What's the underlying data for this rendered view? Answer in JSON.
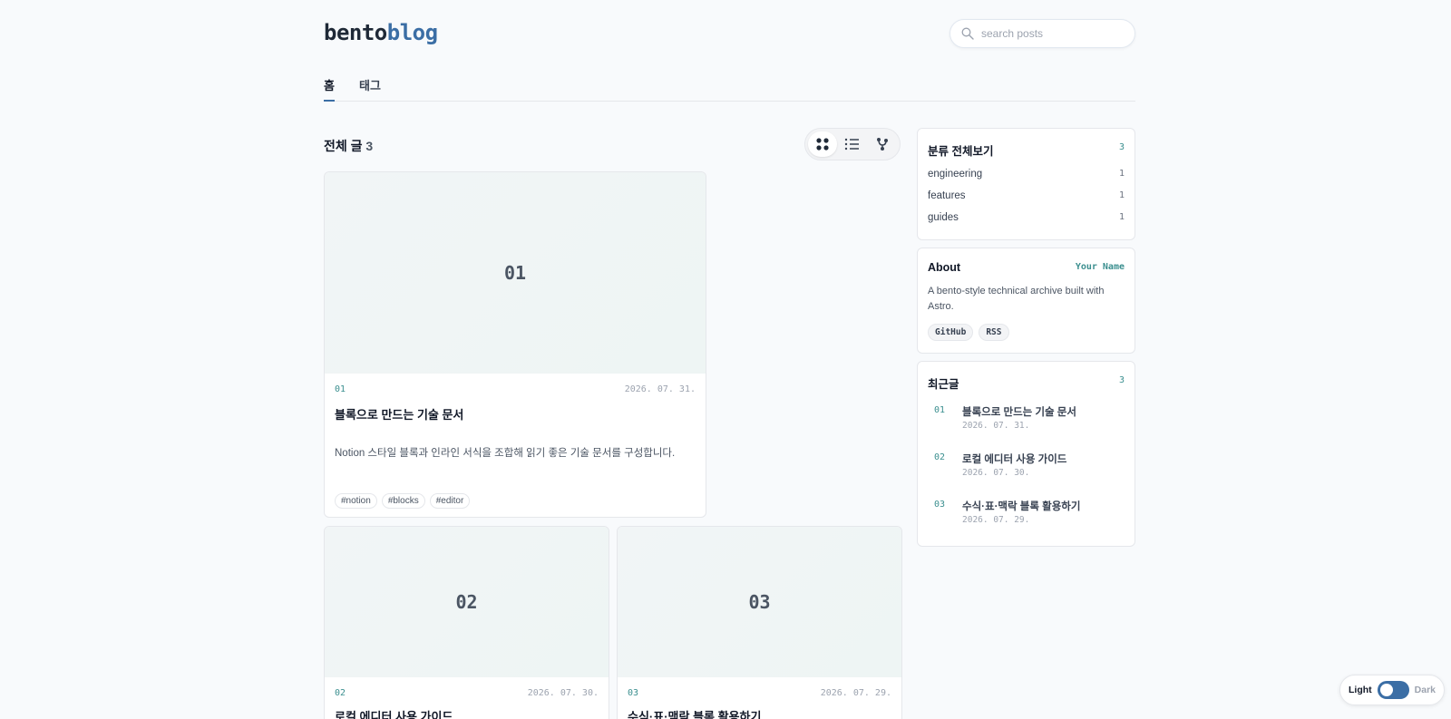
{
  "header": {
    "logo_a": "bento",
    "logo_b": "blog",
    "search_placeholder": "search posts"
  },
  "nav": {
    "tabs": [
      {
        "label": "홈",
        "active": true
      },
      {
        "label": "태그",
        "active": false
      }
    ]
  },
  "main": {
    "heading": "전체 글",
    "count": "3",
    "view_modes": [
      {
        "icon": "grid-icon",
        "active": true
      },
      {
        "icon": "list-icon",
        "active": false
      },
      {
        "icon": "graph-icon",
        "active": false
      }
    ],
    "posts": [
      {
        "thumb": "01",
        "num": "01",
        "date": "2026. 07. 31.",
        "title": "블록으로 만드는 기술 문서",
        "desc": "Notion 스타일 블록과 인라인 서식을 조합해 읽기 좋은 기술 문서를 구성합니다.",
        "tags": [
          "#notion",
          "#blocks",
          "#editor"
        ]
      },
      {
        "thumb": "02",
        "num": "02",
        "date": "2026. 07. 30.",
        "title": "로컬 에디터 사용 가이드"
      },
      {
        "thumb": "03",
        "num": "03",
        "date": "2026. 07. 29.",
        "title": "수식·표·맥락 블록 활용하기"
      }
    ]
  },
  "sidebar": {
    "categories": {
      "title": "분류 전체보기",
      "count": "3",
      "items": [
        {
          "name": "engineering",
          "count": "1"
        },
        {
          "name": "features",
          "count": "1"
        },
        {
          "name": "guides",
          "count": "1"
        }
      ]
    },
    "about": {
      "title": "About",
      "name": "Your Name",
      "desc": "A bento-style technical archive built with Astro.",
      "links": [
        "GitHub",
        "RSS"
      ]
    },
    "recent": {
      "title": "최근글",
      "count": "3",
      "items": [
        {
          "num": "01",
          "title": "블록으로 만드는 기술 문서",
          "date": "2026. 07. 31."
        },
        {
          "num": "02",
          "title": "로컬 에디터 사용 가이드",
          "date": "2026. 07. 30."
        },
        {
          "num": "03",
          "title": "수식·표·맥락 블록 활용하기",
          "date": "2026. 07. 29."
        }
      ]
    }
  },
  "theme": {
    "light": "Light",
    "dark": "Dark",
    "accent": "#3b6ea5"
  }
}
